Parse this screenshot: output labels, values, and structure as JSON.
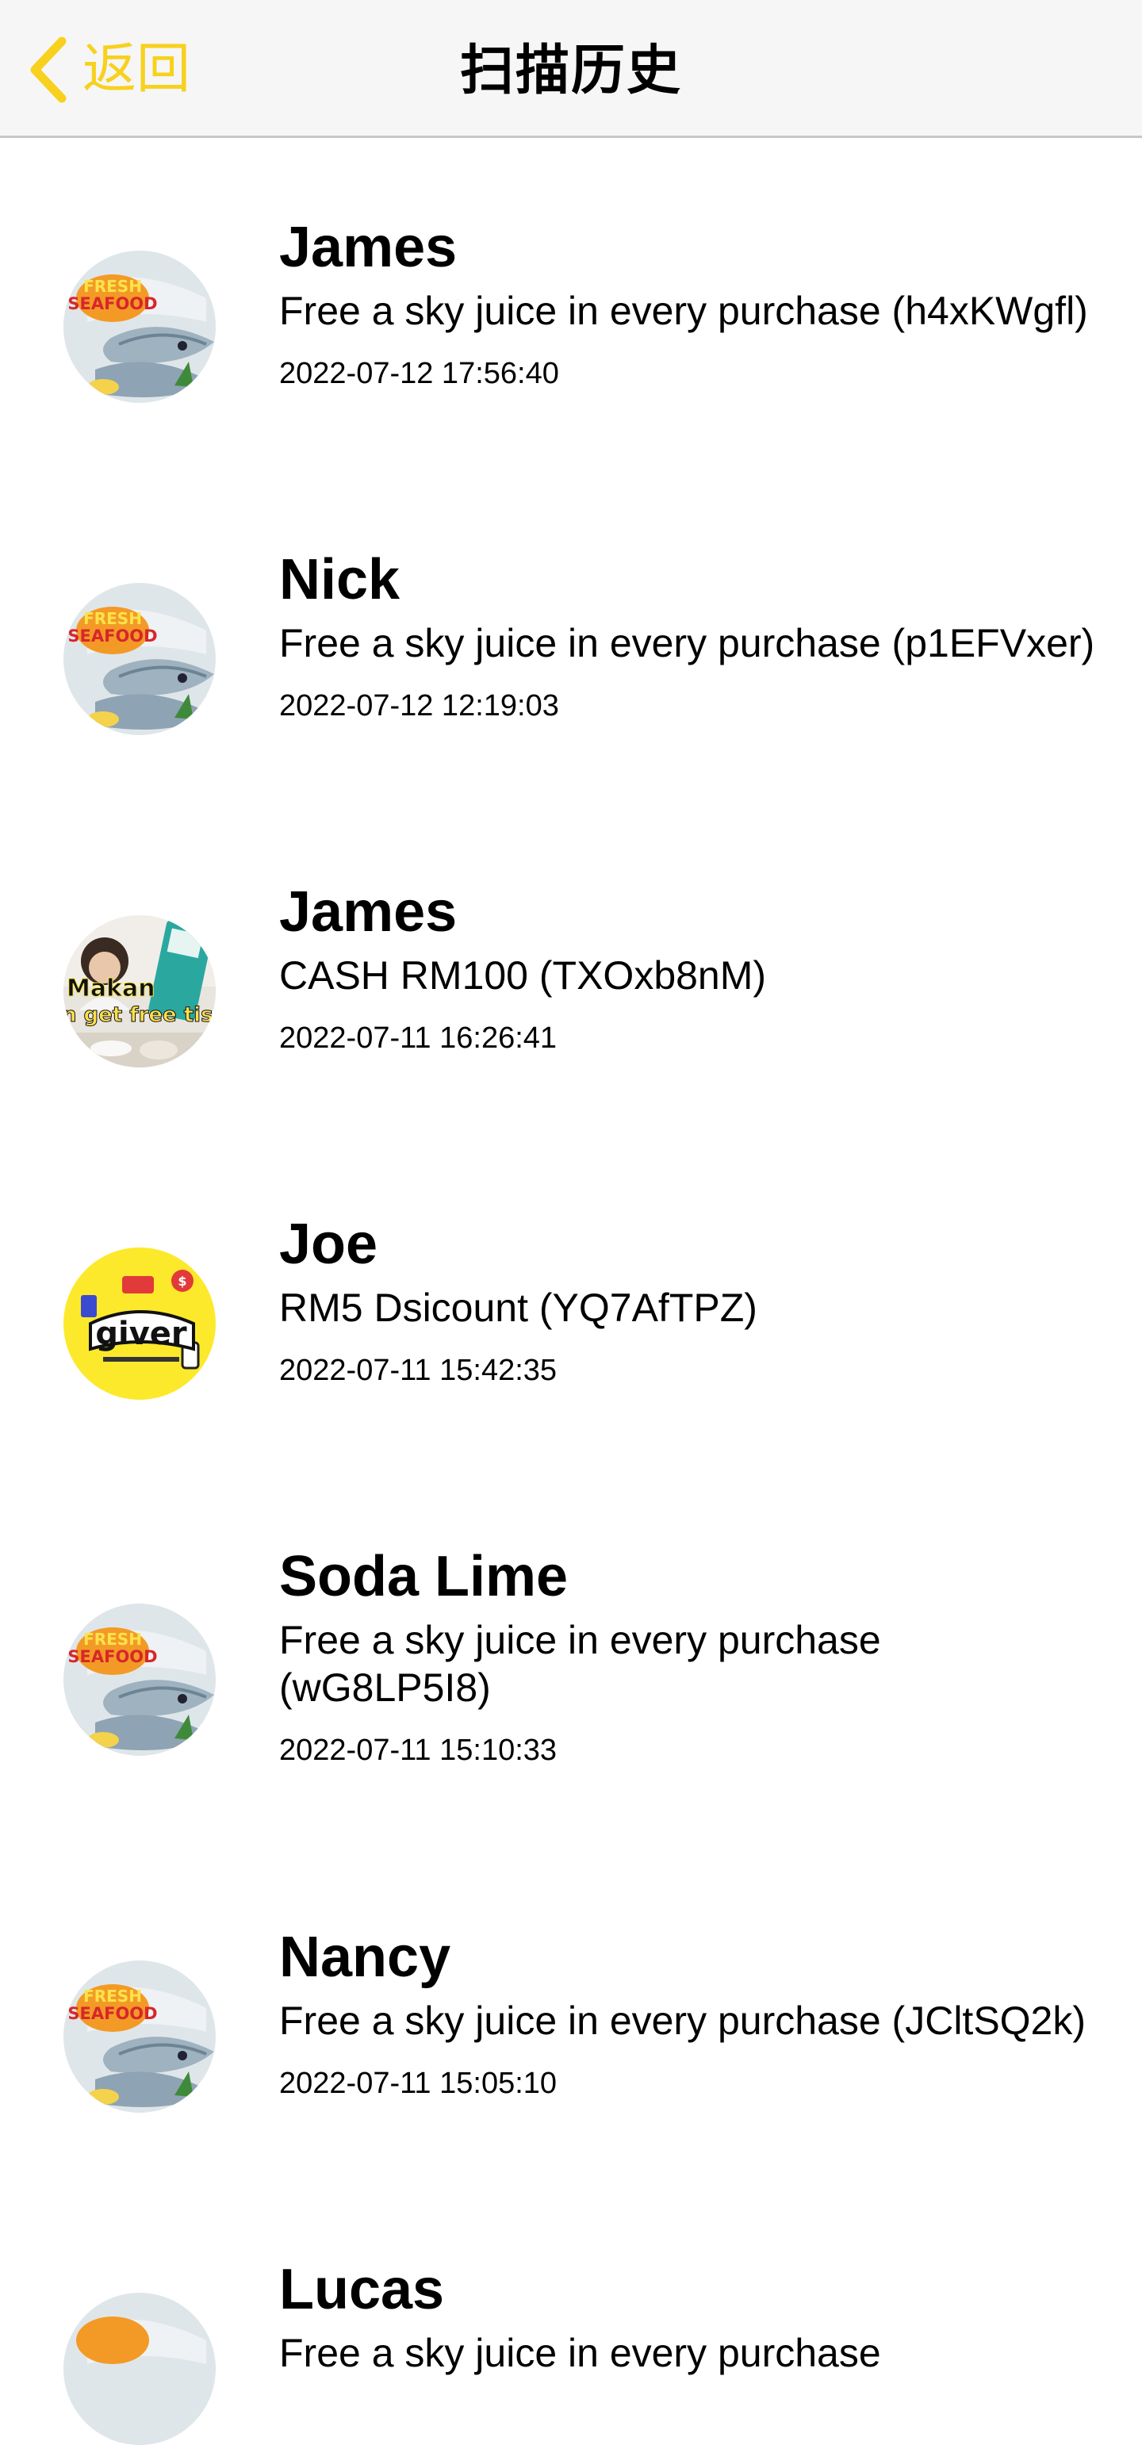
{
  "header": {
    "back_label": "返回",
    "title": "扫描历史",
    "accent_color": "#f7d11d"
  },
  "history": [
    {
      "name": "James",
      "offer": "Free a sky juice in every purchase (h4xKWgfl)",
      "time": "2022-07-12 17:56:40",
      "thumbnail": "fresh-seafood-image"
    },
    {
      "name": "Nick",
      "offer": "Free a sky juice in every purchase (p1EFVxer)",
      "time": "2022-07-12 12:19:03",
      "thumbnail": "fresh-seafood-image"
    },
    {
      "name": "James",
      "offer": "CASH RM100 (TXOxb8nM)",
      "time": "2022-07-11 16:26:41",
      "thumbnail": "makan-free-tissue-image",
      "thumbnail_text": "Makan",
      "thumbnail_text_2": "n get free tiss"
    },
    {
      "name": "Joe",
      "offer": "RM5 Dsicount (YQ7AfTPZ)",
      "time": "2022-07-11 15:42:35",
      "thumbnail": "giver-logo-image",
      "thumbnail_text": "giver"
    },
    {
      "name": "Soda Lime",
      "offer": "Free a sky juice in every purchase (wG8LP5I8)",
      "time": "2022-07-11 15:10:33",
      "thumbnail": "fresh-seafood-image"
    },
    {
      "name": "Nancy",
      "offer": "Free a sky juice in every purchase (JCltSQ2k)",
      "time": "2022-07-11 15:05:10",
      "thumbnail": "fresh-seafood-image"
    },
    {
      "name": "Lucas",
      "offer": "Free a sky juice in every purchase",
      "time": "",
      "thumbnail": "fresh-seafood-image"
    }
  ]
}
